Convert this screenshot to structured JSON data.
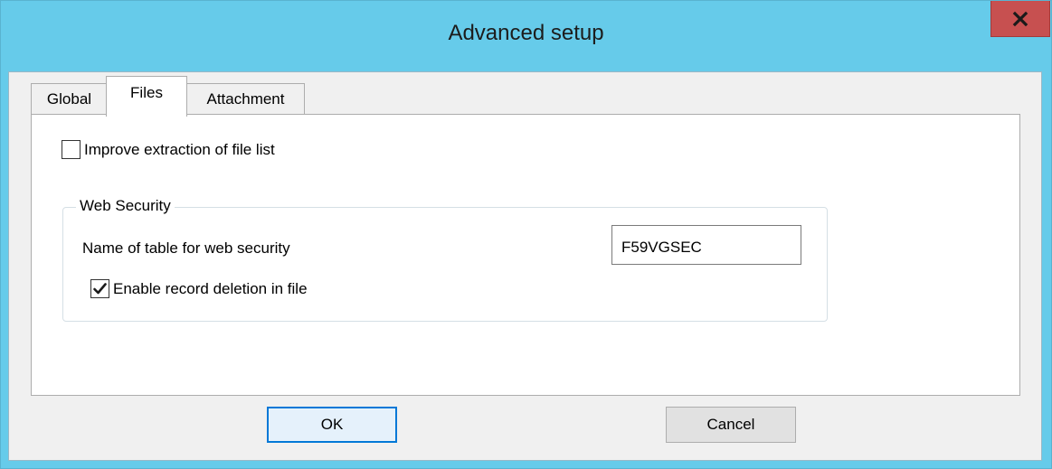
{
  "window": {
    "title": "Advanced setup",
    "close_icon": "close-icon"
  },
  "tabs": [
    {
      "label": "Global",
      "active": false
    },
    {
      "label": "Files",
      "active": true
    },
    {
      "label": "Attachment",
      "active": false
    }
  ],
  "files_tab": {
    "improve_extraction": {
      "label": "Improve extraction of file list",
      "checked": false
    },
    "web_security": {
      "legend": "Web Security",
      "table_name_label": "Name of table for web security",
      "table_name_value": "F59VGSEC",
      "enable_deletion": {
        "label": "Enable record deletion in file",
        "checked": true
      }
    }
  },
  "buttons": {
    "ok_label": "OK",
    "cancel_label": "Cancel"
  },
  "colors": {
    "title_bar": "#66cbea",
    "close_button": "#c75050",
    "focus_border": "#0078d7"
  }
}
